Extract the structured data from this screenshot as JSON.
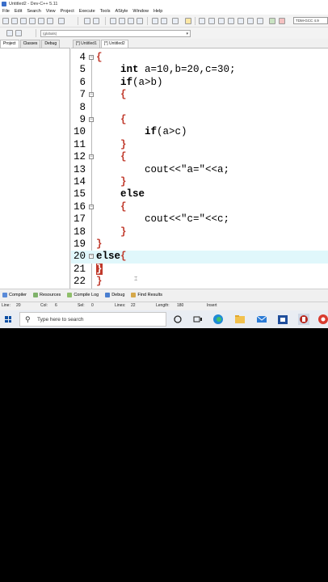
{
  "window": {
    "title": "Untitled2 - Dev-C++ 5.11"
  },
  "menu": [
    "File",
    "Edit",
    "Search",
    "View",
    "Project",
    "Execute",
    "Tools",
    "AStyle",
    "Window",
    "Help"
  ],
  "toolbar": {
    "compiler": "TDM-GCC 4.9"
  },
  "scope_select": {
    "value": "(globals)"
  },
  "left_panel": {
    "tabs": [
      "Project",
      "Classes",
      "Debug"
    ]
  },
  "editor": {
    "tabs": [
      "[*] Untitled1",
      "[*] Untitled2"
    ],
    "lines": [
      {
        "num": "4",
        "text": "{"
      },
      {
        "num": "5",
        "text": "int a=10,b=20,c=30;"
      },
      {
        "num": "6",
        "text": "if(a>b)"
      },
      {
        "num": "7",
        "text": "{"
      },
      {
        "num": "8",
        "text": ""
      },
      {
        "num": "9",
        "text": "{"
      },
      {
        "num": "10",
        "text": "if(a>c)"
      },
      {
        "num": "11",
        "text": "}"
      },
      {
        "num": "12",
        "text": "{"
      },
      {
        "num": "13",
        "text": "cout<<\"a=\"<<a;"
      },
      {
        "num": "14",
        "text": "}"
      },
      {
        "num": "15",
        "text": "else"
      },
      {
        "num": "16",
        "text": "{"
      },
      {
        "num": "17",
        "text": "cout<<\"c=\"<<c;"
      },
      {
        "num": "18",
        "text": "}"
      },
      {
        "num": "19",
        "text": "}"
      },
      {
        "num": "20",
        "text": "else{"
      },
      {
        "num": "21",
        "text": "}"
      },
      {
        "num": "22",
        "text": "}"
      }
    ]
  },
  "bottom_tabs": [
    "Compiler",
    "Resources",
    "Compile Log",
    "Debug",
    "Find Results"
  ],
  "status": {
    "line_label": "Line:",
    "line": "20",
    "col_label": "Col:",
    "col": "6",
    "sel_label": "Sel:",
    "sel": "0",
    "lines_label": "Lines:",
    "lines": "22",
    "length_label": "Length:",
    "length": "180",
    "mode": "Insert"
  },
  "taskbar": {
    "search_placeholder": "Type here to search"
  },
  "colors": {
    "brace": "#c0392b",
    "current_line": "#e0f7fb",
    "taskbar": "#e9edf3"
  }
}
